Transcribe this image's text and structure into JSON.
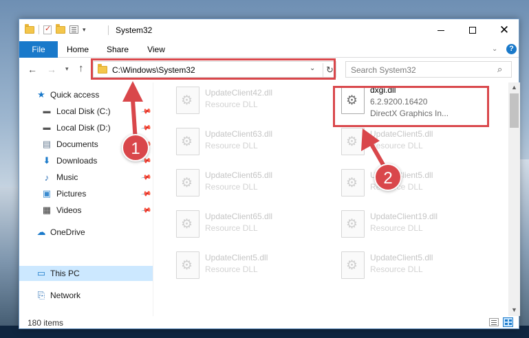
{
  "window": {
    "title": "System32"
  },
  "ribbon": {
    "tabs": [
      "File",
      "Home",
      "Share",
      "View"
    ],
    "help_glyph": "?"
  },
  "nav": {
    "address": "C:\\Windows\\System32",
    "search_placeholder": "Search System32"
  },
  "sidebar": {
    "items": [
      {
        "label": "Quick access",
        "icon": "star-icon",
        "pinned": false
      },
      {
        "label": "Local Disk (C:)",
        "icon": "drive-icon",
        "pinned": true
      },
      {
        "label": "Local Disk (D:)",
        "icon": "drive-icon",
        "pinned": true
      },
      {
        "label": "Documents",
        "icon": "documents-icon",
        "pinned": true
      },
      {
        "label": "Downloads",
        "icon": "download-icon",
        "pinned": true
      },
      {
        "label": "Music",
        "icon": "music-icon",
        "pinned": true
      },
      {
        "label": "Pictures",
        "icon": "pictures-icon",
        "pinned": true
      },
      {
        "label": "Videos",
        "icon": "videos-icon",
        "pinned": true
      },
      {
        "label": "OneDrive",
        "icon": "cloud-icon",
        "pinned": false
      },
      {
        "label": "This PC",
        "icon": "computer-icon",
        "pinned": false,
        "selected": true
      },
      {
        "label": "Network",
        "icon": "network-icon",
        "pinned": false
      }
    ]
  },
  "files": {
    "left_column": [
      {
        "name": "UpdateClient42.dll",
        "type": "Resource DLL"
      },
      {
        "name": "UpdateClient63.dll",
        "type": "Resource DLL"
      },
      {
        "name": "UpdateClient65.dll",
        "type": "Resource DLL"
      },
      {
        "name": "UpdateClient65.dll",
        "type": "Resource DLL"
      },
      {
        "name": "UpdateClient5.dll",
        "type": "Resource DLL"
      }
    ],
    "highlighted": {
      "name": "dxgi.dll",
      "version": "6.2.9200.16420",
      "description": "DirectX Graphics In..."
    },
    "right_column": [
      {
        "name": "UpdateClient5.dll",
        "type": "Resource DLL"
      },
      {
        "name": "UpdateClient5.dll",
        "type": "Resource DLL"
      },
      {
        "name": "UpdateClient19.dll",
        "type": "Resource DLL"
      },
      {
        "name": "UpdateClient5.dll",
        "type": "Resource DLL"
      }
    ]
  },
  "status": {
    "item_count": "180 items"
  },
  "annotations": {
    "marker1": "1",
    "marker2": "2",
    "color": "#d9474b"
  }
}
